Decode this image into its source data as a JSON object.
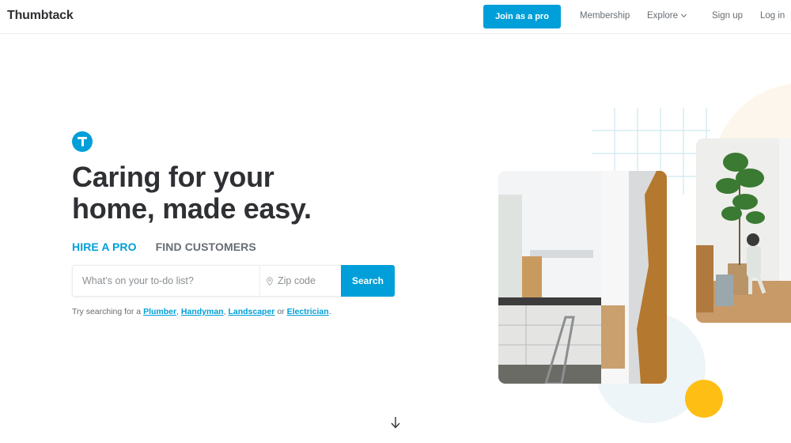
{
  "header": {
    "logo": "Thumbtack",
    "join_button": "Join as a pro",
    "nav": {
      "membership": "Membership",
      "explore": "Explore",
      "sign_up": "Sign up",
      "log_in": "Log in"
    }
  },
  "hero": {
    "badge_letter": "T",
    "headline_line1": "Caring for your",
    "headline_line2": "home, made easy.",
    "tabs": [
      {
        "label": "HIRE A PRO",
        "active": true
      },
      {
        "label": "FIND CUSTOMERS",
        "active": false
      }
    ],
    "search": {
      "todo_placeholder": "What’s on your to-do list?",
      "todo_value": "",
      "zip_placeholder": "Zip code",
      "zip_value": "",
      "button": "Search"
    },
    "suggestions": {
      "prefix": "Try searching for a ",
      "links": [
        "Plumber",
        "Handyman",
        "Landscaper",
        "Electrician"
      ],
      "sep1": ", ",
      "sep2": ", ",
      "sep3": " or ",
      "suffix": "."
    },
    "images": {
      "kitchen": "kitchen-renovation-photo",
      "plant": "living-room-plant-child-photo"
    }
  },
  "colors": {
    "brand": "#009fd9",
    "text": "#2f3033",
    "muted": "#676d73",
    "accent_yellow": "#febe14"
  }
}
